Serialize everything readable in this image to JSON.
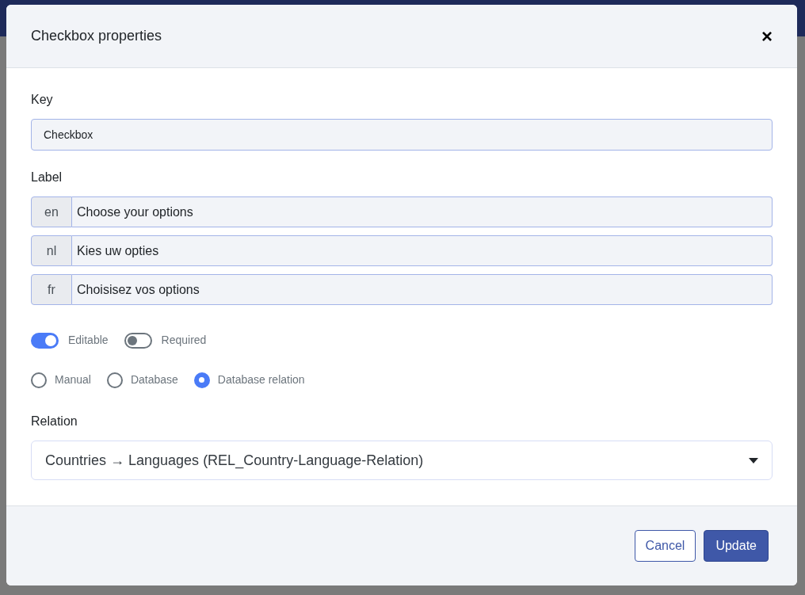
{
  "dialog": {
    "title": "Checkbox properties",
    "close": "×"
  },
  "key": {
    "label": "Key",
    "value": "Checkbox"
  },
  "label": {
    "label": "Label",
    "translations": [
      {
        "lang": "en",
        "value": "Choose your options"
      },
      {
        "lang": "nl",
        "value": "Kies uw opties"
      },
      {
        "lang": "fr",
        "value": "Choisisez vos options"
      }
    ]
  },
  "toggles": [
    {
      "label": "Editable",
      "on": true
    },
    {
      "label": "Required",
      "on": false
    }
  ],
  "sources": [
    {
      "label": "Manual",
      "selected": false
    },
    {
      "label": "Database",
      "selected": false
    },
    {
      "label": "Database relation",
      "selected": true
    }
  ],
  "relation": {
    "label": "Relation",
    "value": "Countries → Languages (REL_Country-Language-Relation)"
  },
  "buttons": [
    {
      "label": "Cancel",
      "kind": "secondary"
    },
    {
      "label": "Update",
      "kind": "primary"
    }
  ]
}
